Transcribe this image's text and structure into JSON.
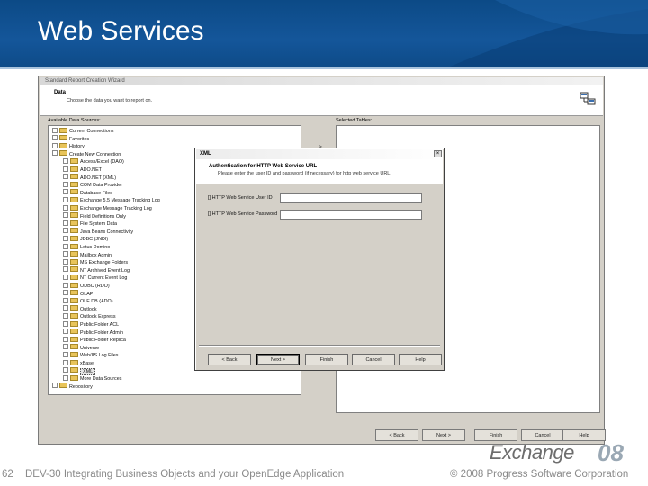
{
  "slide": {
    "title": "Web Services",
    "page_number": "62",
    "footer_left": "DEV-30 Integrating Business Objects and your OpenEdge Application",
    "footer_right": "© 2008 Progress Software Corporation",
    "logo_text": "Exchange",
    "logo_year": "08"
  },
  "wizard": {
    "title": "Standard Report Creation Wizard",
    "header_title": "Data",
    "header_subtitle": "Choose the data you want to report on.",
    "available_label": "Available Data Sources:",
    "selected_label": "Selected Tables:",
    "tree": [
      {
        "label": "Current Connections",
        "expander": "plus",
        "indent": 0
      },
      {
        "label": "Favorites",
        "expander": "plus",
        "indent": 0
      },
      {
        "label": "History",
        "expander": "plus",
        "indent": 0
      },
      {
        "label": "Create New Connection",
        "expander": "minus",
        "indent": 0
      },
      {
        "label": "Access/Excel (DAO)",
        "expander": "plus",
        "indent": 1
      },
      {
        "label": "ADO.NET",
        "expander": "plus",
        "indent": 1
      },
      {
        "label": "ADO.NET (XML)",
        "expander": "plus",
        "indent": 1
      },
      {
        "label": "COM Data Provider",
        "expander": "plus",
        "indent": 1
      },
      {
        "label": "Database Files",
        "expander": "plus",
        "indent": 1
      },
      {
        "label": "Exchange 5.5 Message Tracking Log",
        "expander": "plus",
        "indent": 1
      },
      {
        "label": "Exchange Message Tracking Log",
        "expander": "plus",
        "indent": 1
      },
      {
        "label": "Field Definitions Only",
        "expander": "plus",
        "indent": 1
      },
      {
        "label": "File System Data",
        "expander": "plus",
        "indent": 1
      },
      {
        "label": "Java Beans Connectivity",
        "expander": "plus",
        "indent": 1
      },
      {
        "label": "JDBC (JNDI)",
        "expander": "plus",
        "indent": 1
      },
      {
        "label": "Lotus Domino",
        "expander": "plus",
        "indent": 1
      },
      {
        "label": "Mailbox Admin",
        "expander": "plus",
        "indent": 1
      },
      {
        "label": "MS Exchange Folders",
        "expander": "plus",
        "indent": 1
      },
      {
        "label": "NT Archived Event Log",
        "expander": "plus",
        "indent": 1
      },
      {
        "label": "NT Current Event Log",
        "expander": "plus",
        "indent": 1
      },
      {
        "label": "ODBC (RDO)",
        "expander": "plus",
        "indent": 1
      },
      {
        "label": "OLAP",
        "expander": "plus",
        "indent": 1
      },
      {
        "label": "OLE DB (ADO)",
        "expander": "plus",
        "indent": 1
      },
      {
        "label": "Outlook",
        "expander": "plus",
        "indent": 1
      },
      {
        "label": "Outlook Express",
        "expander": "plus",
        "indent": 1
      },
      {
        "label": "Public Folder ACL",
        "expander": "plus",
        "indent": 1
      },
      {
        "label": "Public Folder Admin",
        "expander": "plus",
        "indent": 1
      },
      {
        "label": "Public Folder Replica",
        "expander": "plus",
        "indent": 1
      },
      {
        "label": "Universe",
        "expander": "plus",
        "indent": 1
      },
      {
        "label": "Web/IIS Log Files",
        "expander": "plus",
        "indent": 1
      },
      {
        "label": "xBase",
        "expander": "plus",
        "indent": 1
      },
      {
        "label": "XML",
        "expander": "plus",
        "indent": 1,
        "highlighted": true
      },
      {
        "label": "More Data Sources",
        "expander": "plus",
        "indent": 1
      },
      {
        "label": "Repository",
        "expander": "plus",
        "indent": 0
      }
    ],
    "buttons": {
      "back": "< Back",
      "next": "Next >",
      "finish": "Finish",
      "cancel": "Cancel",
      "help": "Help"
    },
    "move_right_glyph": ">",
    "move_all_right_glyph": ">>"
  },
  "xml_dialog": {
    "title": "XML",
    "close_glyph": "×",
    "header_title": "Authentication for HTTP Web Service URL",
    "header_subtitle": "Please enter the user ID and password (if necessary) for http web service URL.",
    "fields": [
      {
        "label": "HTTP Web Service User ID",
        "value": ""
      },
      {
        "label": "HTTP Web Service Password",
        "value": ""
      }
    ],
    "buttons": {
      "back": "< Back",
      "next": "Next >",
      "finish": "Finish",
      "cancel": "Cancel",
      "help": "Help"
    }
  }
}
